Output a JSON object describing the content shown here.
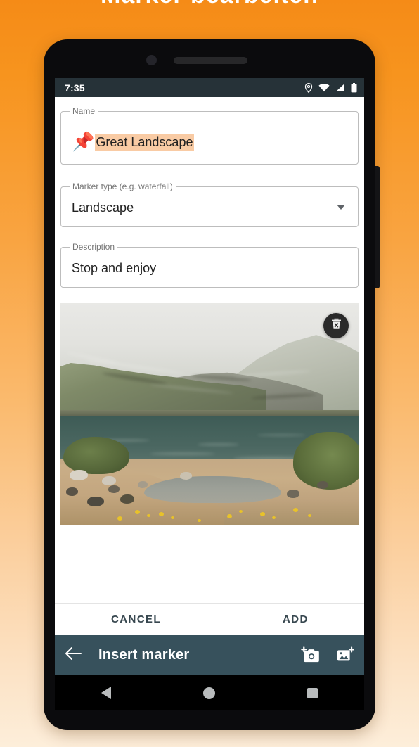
{
  "page": {
    "background_gradient_top": "#F7941E",
    "background_gradient_bottom": "#FDEEDA",
    "cut_off_heading": "Marker bearbeiten"
  },
  "status_bar": {
    "time": "7:35",
    "icons": [
      "location-pin-icon",
      "wifi-icon",
      "signal-icon",
      "battery-icon"
    ],
    "background": "#263238"
  },
  "form": {
    "name_field": {
      "label": "Name",
      "value": "Great Landscape",
      "emoji": "📌",
      "highlight_color": "#F9CBA4"
    },
    "marker_type_field": {
      "label": "Marker type (e.g. waterfall)",
      "value": "Landscape",
      "arrow_icon": "chevron-down-icon"
    },
    "description_field": {
      "label": "Description",
      "value": "Stop and enjoy"
    }
  },
  "photo": {
    "alt": "Mountain lake with misty peaks, rocky shore and yellow flowers",
    "delete_icon": "trash-icon"
  },
  "actions": {
    "cancel_label": "CANCEL",
    "add_label": "ADD",
    "text_color": "#37474F"
  },
  "app_bar": {
    "title": "Insert marker",
    "back_icon": "arrow-left-icon",
    "camera_icon": "add-a-photo-icon",
    "gallery_icon": "add-image-icon",
    "background": "#37515C"
  },
  "nav_bar": {
    "back_icon": "triangle-back-icon",
    "home_icon": "circle-home-icon",
    "recents_icon": "square-recents-icon"
  }
}
